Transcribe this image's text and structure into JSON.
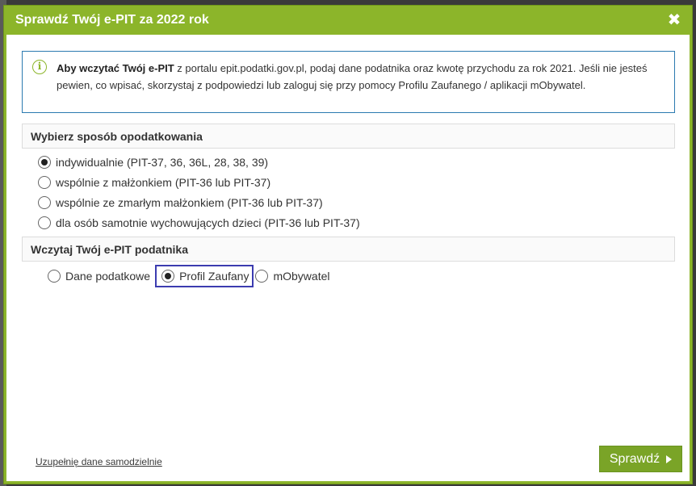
{
  "dialog": {
    "title": "Sprawdź Twój e-PIT za 2022 rok",
    "close_label": "✖"
  },
  "info": {
    "icon": "info-icon",
    "bold_text": "Aby wczytać Twój e-PIT",
    "text": " z portalu epit.podatki.gov.pl, podaj dane podatnika oraz kwotę przychodu za rok 2021. Jeśli nie jesteś pewien, co wpisać, skorzystaj z podpowiedzi lub zaloguj się przy pomocy Profilu Zaufanego / aplikacji mObywatel."
  },
  "taxation": {
    "header": "Wybierz sposób opodatkowania",
    "options": [
      {
        "label": "indywidualnie (PIT-37, 36, 36L, 28, 38, 39)",
        "checked": true
      },
      {
        "label": "wspólnie z małżonkiem (PIT-36 lub PIT-37)",
        "checked": false
      },
      {
        "label": "wspólnie ze zmarłym małżonkiem (PIT-36 lub PIT-37)",
        "checked": false
      },
      {
        "label": "dla osób samotnie wychowujących dzieci (PIT-36 lub PIT-37)",
        "checked": false
      }
    ]
  },
  "load": {
    "header": "Wczytaj Twój e-PIT podatnika",
    "options": [
      {
        "label": "Dane podatkowe",
        "checked": false
      },
      {
        "label": "Profil Zaufany",
        "checked": true
      },
      {
        "label": "mObywatel",
        "checked": false
      }
    ]
  },
  "footer": {
    "manual_link": "Uzupełnię dane samodzielnie",
    "submit_label": "Sprawdź"
  }
}
